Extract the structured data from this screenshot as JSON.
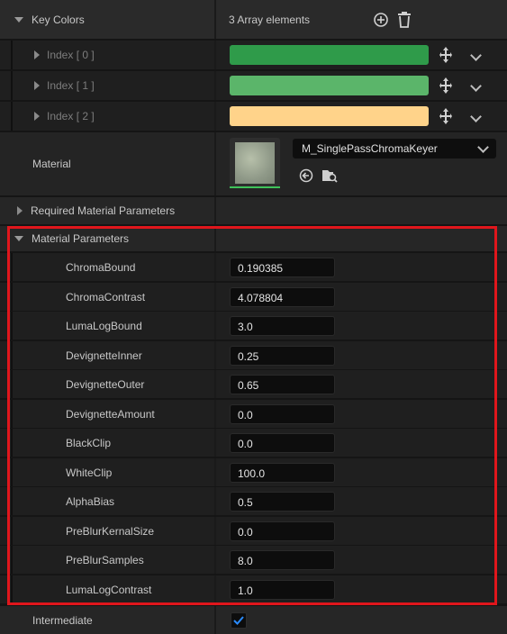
{
  "key_colors": {
    "label": "Key Colors",
    "count_text": "3 Array elements",
    "items": [
      {
        "label": "Index [ 0 ]",
        "color": "#2f9b4a"
      },
      {
        "label": "Index [ 1 ]",
        "color": "#5bb56a"
      },
      {
        "label": "Index [ 2 ]",
        "color": "#ffd38a"
      }
    ]
  },
  "material": {
    "label": "Material",
    "selected": "M_SinglePassChromaKeyer"
  },
  "required_params": {
    "label": "Required Material Parameters"
  },
  "material_params": {
    "label": "Material Parameters",
    "highlight_color": "#e0161c",
    "items": [
      {
        "label": "ChromaBound",
        "value": "0.190385"
      },
      {
        "label": "ChromaContrast",
        "value": "4.078804"
      },
      {
        "label": "LumaLogBound",
        "value": "3.0"
      },
      {
        "label": "DevignetteInner",
        "value": "0.25"
      },
      {
        "label": "DevignetteOuter",
        "value": "0.65"
      },
      {
        "label": "DevignetteAmount",
        "value": "0.0"
      },
      {
        "label": "BlackClip",
        "value": "0.0"
      },
      {
        "label": "WhiteClip",
        "value": "100.0"
      },
      {
        "label": "AlphaBias",
        "value": "0.5"
      },
      {
        "label": "PreBlurKernalSize",
        "value": "0.0"
      },
      {
        "label": "PreBlurSamples",
        "value": "8.0"
      },
      {
        "label": "LumaLogContrast",
        "value": "1.0"
      }
    ]
  },
  "intermediate": {
    "label": "Intermediate",
    "checked": true
  }
}
